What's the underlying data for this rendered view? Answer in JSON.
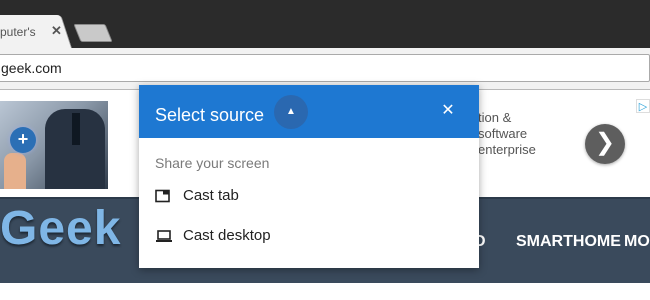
{
  "browser": {
    "tab_title": "puter's",
    "tab_close": "✕",
    "url": "geek.com"
  },
  "ad": {
    "plus_symbol": "+",
    "text_lines": [
      "tion &",
      "software",
      "enterprise"
    ],
    "choices_icon": "ad-choices-icon",
    "next_symbol": "❯"
  },
  "site": {
    "logo": "Geek",
    "nav_items": [
      "D",
      "SMARTHOME",
      "MOF"
    ]
  },
  "cast_dialog": {
    "title": "Select source",
    "toggle_symbol": "▲",
    "close_symbol": "✕",
    "subheader": "Share your screen",
    "items": [
      {
        "label": "Cast tab",
        "icon": "tab-icon"
      },
      {
        "label": "Cast desktop",
        "icon": "laptop-icon"
      }
    ],
    "header_color": "#1e78d2"
  }
}
